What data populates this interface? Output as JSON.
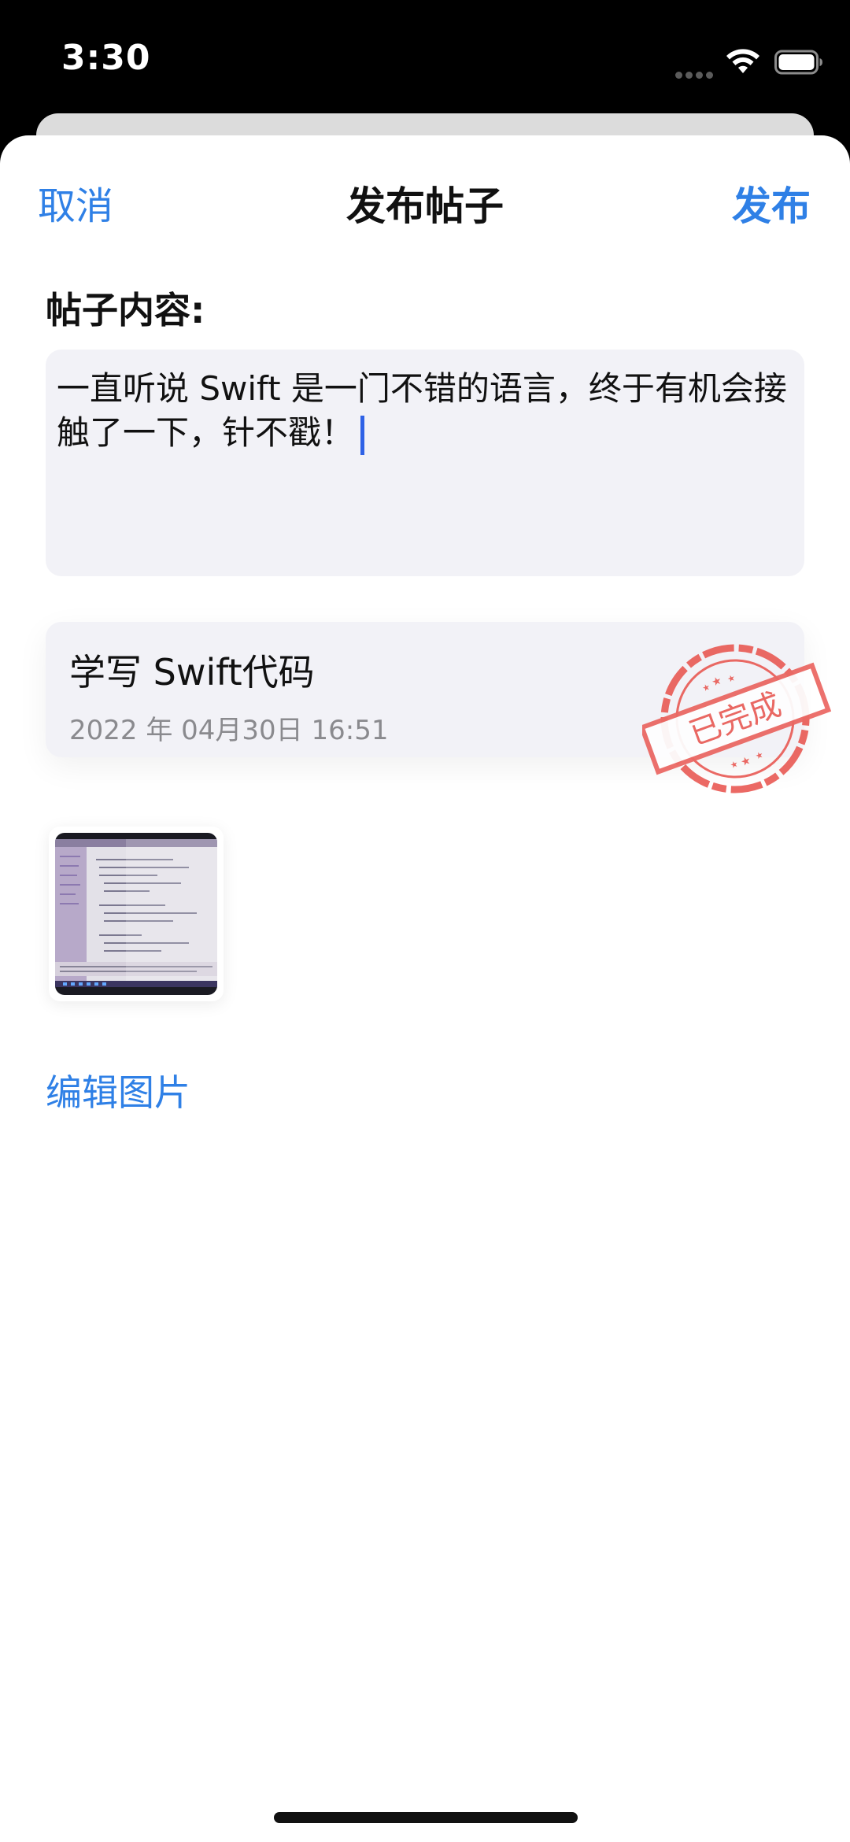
{
  "status_bar": {
    "time": "3:30"
  },
  "nav": {
    "cancel_label": "取消",
    "title": "发布帖子",
    "publish_label": "发布"
  },
  "post": {
    "content_label": "帖子内容:",
    "content_text": "一直听说 Swift 是一门不错的语言，终于有机会接触了一下，针不戳！"
  },
  "task": {
    "title": "学写 Swift代码",
    "date": "2022 年 04月30日 16:51",
    "stamp_text": "已完成"
  },
  "images": {
    "edit_label": "编辑图片",
    "thumbnail_icon": "code-screenshot-photo"
  },
  "colors": {
    "accent": "#2f80e6",
    "stamp": "#e8504a",
    "field_background": "#f2f2f7"
  },
  "icons": [
    "wifi-icon",
    "battery-icon",
    "cellular-dots-icon",
    "caret-icon",
    "completed-stamp-icon"
  ]
}
